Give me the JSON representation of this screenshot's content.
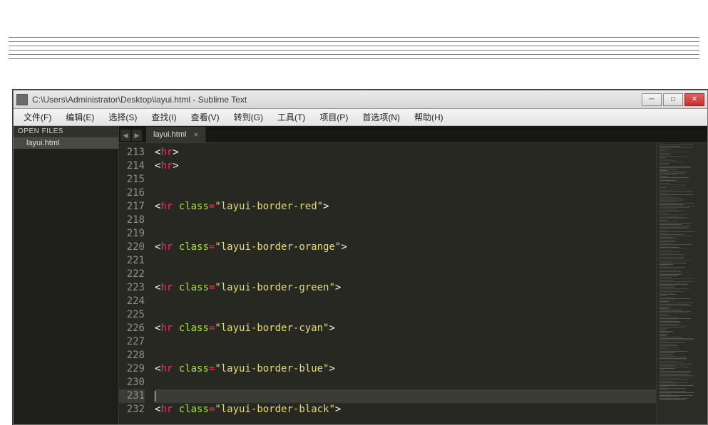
{
  "preview": {
    "rules": [
      "default",
      "red",
      "orange",
      "green",
      "cyan",
      "blue"
    ]
  },
  "titlebar": {
    "text": "C:\\Users\\Administrator\\Desktop\\layui.html - Sublime Text"
  },
  "menu": {
    "items": [
      "文件(F)",
      "编辑(E)",
      "选择(S)",
      "查找(I)",
      "查看(V)",
      "转到(G)",
      "工具(T)",
      "项目(P)",
      "首选项(N)",
      "帮助(H)"
    ]
  },
  "sidebar": {
    "heading": "OPEN FILES",
    "files": [
      "layui.html"
    ]
  },
  "tabs": {
    "active": "layui.html"
  },
  "editor": {
    "first_line": 213,
    "highlight_line": 231,
    "lines": [
      {
        "n": 213,
        "tokens": [
          {
            "t": "p",
            "v": "<"
          },
          {
            "t": "tag",
            "v": "hr"
          },
          {
            "t": "p",
            "v": ">"
          }
        ]
      },
      {
        "n": 214,
        "tokens": [
          {
            "t": "p",
            "v": "<"
          },
          {
            "t": "tag",
            "v": "hr"
          },
          {
            "t": "p",
            "v": ">"
          }
        ]
      },
      {
        "n": 215,
        "tokens": []
      },
      {
        "n": 216,
        "tokens": []
      },
      {
        "n": 217,
        "tokens": [
          {
            "t": "p",
            "v": "<"
          },
          {
            "t": "tag",
            "v": "hr"
          },
          {
            "t": "p",
            "v": " "
          },
          {
            "t": "attr",
            "v": "class"
          },
          {
            "t": "op",
            "v": "="
          },
          {
            "t": "str",
            "v": "\"layui-border-red\""
          },
          {
            "t": "p",
            "v": ">"
          }
        ]
      },
      {
        "n": 218,
        "tokens": []
      },
      {
        "n": 219,
        "tokens": []
      },
      {
        "n": 220,
        "tokens": [
          {
            "t": "p",
            "v": "<"
          },
          {
            "t": "tag",
            "v": "hr"
          },
          {
            "t": "p",
            "v": " "
          },
          {
            "t": "attr",
            "v": "class"
          },
          {
            "t": "op",
            "v": "="
          },
          {
            "t": "str",
            "v": "\"layui-border-orange\""
          },
          {
            "t": "p",
            "v": ">"
          }
        ]
      },
      {
        "n": 221,
        "tokens": []
      },
      {
        "n": 222,
        "tokens": []
      },
      {
        "n": 223,
        "tokens": [
          {
            "t": "p",
            "v": "<"
          },
          {
            "t": "tag",
            "v": "hr"
          },
          {
            "t": "p",
            "v": " "
          },
          {
            "t": "attr",
            "v": "class"
          },
          {
            "t": "op",
            "v": "="
          },
          {
            "t": "str",
            "v": "\"layui-border-green\""
          },
          {
            "t": "p",
            "v": ">"
          }
        ]
      },
      {
        "n": 224,
        "tokens": []
      },
      {
        "n": 225,
        "tokens": []
      },
      {
        "n": 226,
        "tokens": [
          {
            "t": "p",
            "v": "<"
          },
          {
            "t": "tag",
            "v": "hr"
          },
          {
            "t": "p",
            "v": " "
          },
          {
            "t": "attr",
            "v": "class"
          },
          {
            "t": "op",
            "v": "="
          },
          {
            "t": "str",
            "v": "\"layui-border-cyan\""
          },
          {
            "t": "p",
            "v": ">"
          }
        ]
      },
      {
        "n": 227,
        "tokens": []
      },
      {
        "n": 228,
        "tokens": []
      },
      {
        "n": 229,
        "tokens": [
          {
            "t": "p",
            "v": "<"
          },
          {
            "t": "tag",
            "v": "hr"
          },
          {
            "t": "p",
            "v": " "
          },
          {
            "t": "attr",
            "v": "class"
          },
          {
            "t": "op",
            "v": "="
          },
          {
            "t": "str",
            "v": "\"layui-border-blue\""
          },
          {
            "t": "p",
            "v": ">"
          }
        ]
      },
      {
        "n": 230,
        "tokens": []
      },
      {
        "n": 231,
        "tokens": []
      },
      {
        "n": 232,
        "tokens": [
          {
            "t": "p",
            "v": "<"
          },
          {
            "t": "tag",
            "v": "hr"
          },
          {
            "t": "p",
            "v": " "
          },
          {
            "t": "attr",
            "v": "class"
          },
          {
            "t": "op",
            "v": "="
          },
          {
            "t": "str",
            "v": "\"layui-border-black\""
          },
          {
            "t": "p",
            "v": ">"
          }
        ]
      }
    ]
  }
}
